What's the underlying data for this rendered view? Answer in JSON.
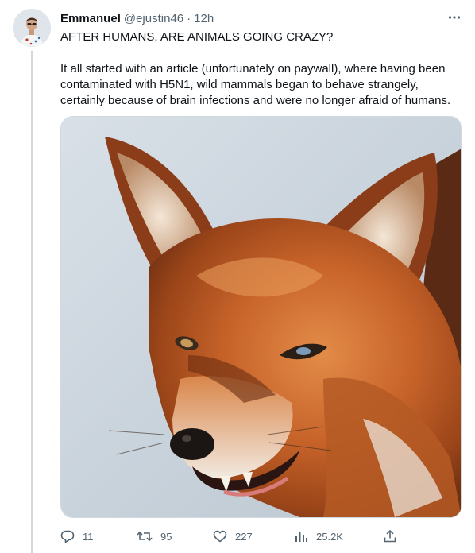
{
  "tweet": {
    "author_name": "Emmanuel",
    "handle": "@ejustin46",
    "separator": "·",
    "time": "12h",
    "text_line1": "AFTER HUMANS, ARE ANIMALS GOING CRAZY?",
    "text_paragraph2": "It all started with an article (unfortunately on paywall), where having been contaminated with H5N1, wild mammals began to behave strangely, certainly because of brain infections and were no longer afraid of humans.",
    "media_subject": "snarling red fox close-up photo",
    "stats": {
      "replies": "11",
      "retweets": "95",
      "likes": "227",
      "views": "25.2K"
    }
  },
  "icons": {
    "more": "more-horizontal-icon",
    "reply": "reply-bubble-icon",
    "retweet": "retweet-arrows-icon",
    "like": "heart-icon",
    "views": "bar-chart-icon",
    "share": "share-upload-icon"
  },
  "colors": {
    "text_primary": "#0f1419",
    "text_secondary": "#536471",
    "border": "#cfd9de",
    "fox_fur": "#c8642a",
    "background_sky": "#cdd6df"
  }
}
